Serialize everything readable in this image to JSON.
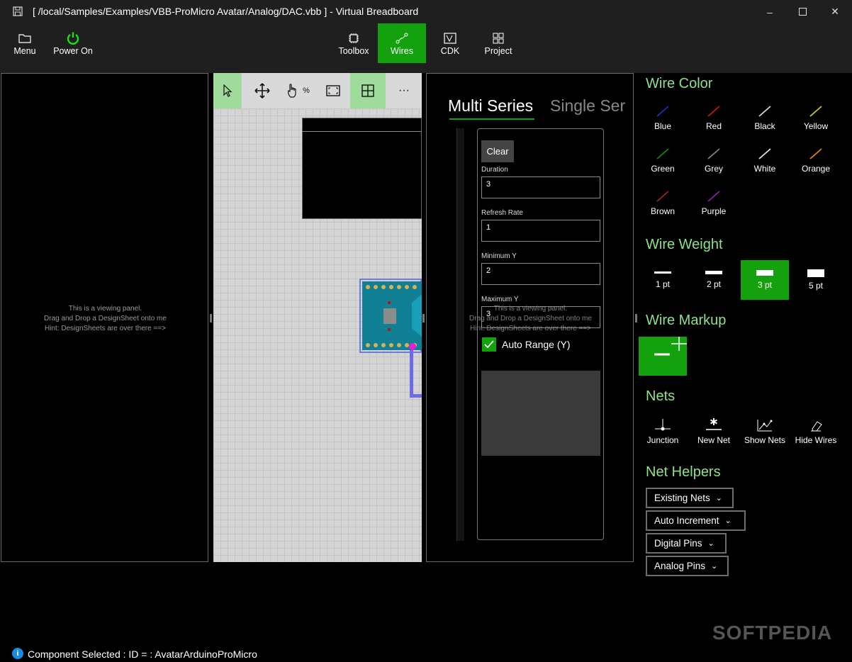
{
  "window": {
    "title": "[ /local/Samples/Examples/VBB-ProMicro Avatar/Analog/DAC.vbb ] - Virtual Breadboard"
  },
  "toolbar": {
    "menu": "Menu",
    "power": "Power On",
    "toolbox": "Toolbox",
    "wires": "Wires",
    "cdk": "CDK",
    "project": "Project"
  },
  "viewer": {
    "hint1": "This is a viewing panel.",
    "hint2": "Drag and Drop a DesignSheet onto me",
    "hint3": "Hint: DesignSheets are over there ==>"
  },
  "canvas": {
    "zoom_symbol": "%",
    "more": "···"
  },
  "scope": {
    "tab_multi": "Multi Series",
    "tab_single": "Single Ser",
    "clear": "Clear",
    "duration_label": "Duration",
    "duration": "3",
    "refresh_label": "Refresh Rate",
    "refresh": "1",
    "miny_label": "Minimum Y",
    "miny": "2",
    "maxy_label": "Maximum Y",
    "maxy": "3",
    "auto_range": "Auto Range (Y)"
  },
  "wire_color": {
    "title": "Wire Color",
    "colors": [
      {
        "label": "Blue",
        "hex": "#1f2fd0"
      },
      {
        "label": "Red",
        "hex": "#d01818"
      },
      {
        "label": "Black",
        "hex": "#e0e0e0"
      },
      {
        "label": "Yellow",
        "hex": "#d8d020"
      },
      {
        "label": "Green",
        "hex": "#148c14"
      },
      {
        "label": "Grey",
        "hex": "#8a8a8a"
      },
      {
        "label": "White",
        "hex": "#f0f0f0"
      },
      {
        "label": "Orange",
        "hex": "#e08a10"
      },
      {
        "label": "Brown",
        "hex": "#a02828"
      },
      {
        "label": "Purple",
        "hex": "#9020b0"
      }
    ]
  },
  "wire_weight": {
    "title": "Wire Weight",
    "weights": [
      "1 pt",
      "2 pt",
      "3 pt",
      "5 pt"
    ],
    "selected": "3 pt"
  },
  "wire_markup": {
    "title": "Wire Markup"
  },
  "nets": {
    "title": "Nets",
    "junction": "Junction",
    "new_net": "New Net",
    "show_nets": "Show Nets",
    "hide_wires": "Hide Wires"
  },
  "net_helpers": {
    "title": "Net Helpers",
    "existing": "Existing Nets",
    "auto_increment": "Auto Increment",
    "digital": "Digital Pins",
    "analog": "Analog Pins"
  },
  "status": {
    "text": "Component Selected : ID =  : AvatarArduinoProMicro"
  },
  "watermark": "SOFTPEDIA",
  "colors": {
    "accent": "#13a10e",
    "section": "#8fe08a"
  }
}
